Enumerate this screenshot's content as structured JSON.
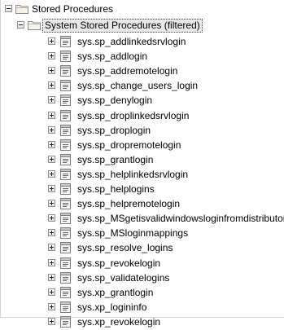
{
  "tree": {
    "root": {
      "label": "Stored Procedures"
    },
    "system_folder": {
      "label": "System Stored Procedures (filtered)"
    },
    "procedures": [
      "sys.sp_addlinkedsrvlogin",
      "sys.sp_addlogin",
      "sys.sp_addremotelogin",
      "sys.sp_change_users_login",
      "sys.sp_denylogin",
      "sys.sp_droplinkedsrvlogin",
      "sys.sp_droplogin",
      "sys.sp_dropremotelogin",
      "sys.sp_grantlogin",
      "sys.sp_helplinkedsrvlogin",
      "sys.sp_helplogins",
      "sys.sp_helpremotelogin",
      "sys.sp_MSgetisvalidwindowsloginfromdistributor",
      "sys.sp_MSloginmappings",
      "sys.sp_resolve_logins",
      "sys.sp_revokelogin",
      "sys.sp_validatelogins",
      "sys.xp_grantlogin",
      "sys.xp_logininfo",
      "sys.xp_revokelogin"
    ]
  },
  "icons": {
    "folder": "folder-icon",
    "procedure": "stored-procedure-icon",
    "expanded": "collapse-minus-icon",
    "collapsed": "expand-plus-icon"
  },
  "colors": {
    "selection_bg": "#e8e8e8",
    "folder_fill": "#f4f2e9",
    "folder_stroke": "#8a8a86"
  }
}
